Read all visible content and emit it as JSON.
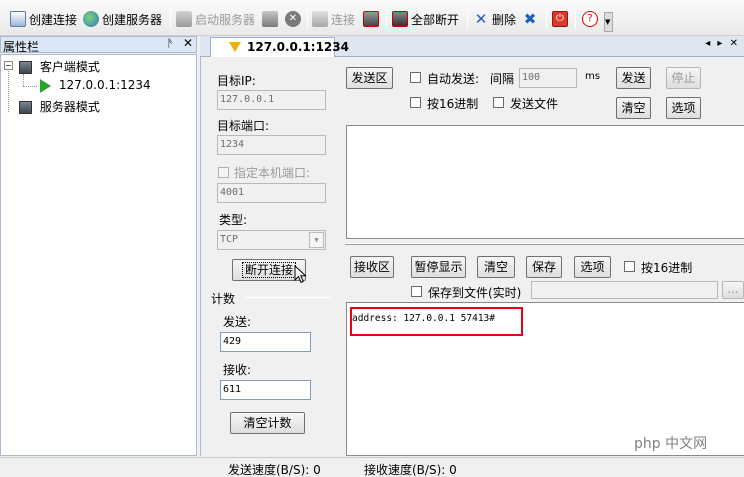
{
  "toolbar": {
    "create_connection": "创建连接",
    "create_server": "创建服务器",
    "start_server": "启动服务器",
    "connect": "连接",
    "disconnect_all": "全部断开",
    "delete": "删除"
  },
  "left_panel": {
    "title": "属性栏",
    "pin": "ᚫ",
    "close": "✕",
    "tree": {
      "client_mode": "客户端模式",
      "client_connection": "127.0.0.1:1234",
      "server_mode": "服务器模式"
    }
  },
  "tab": {
    "label": "127.0.0.1:1234",
    "nav": "◂ ▸ ✕"
  },
  "connection": {
    "target_ip_label": "目标IP:",
    "target_ip": "127.0.0.1",
    "target_port_label": "目标端口:",
    "target_port": "1234",
    "local_port_label": "指定本机端口:",
    "local_port": "4001",
    "type_label": "类型:",
    "type_value": "TCP",
    "disconnect_button": "断开连接"
  },
  "counts": {
    "title": "计数",
    "sent_label": "发送:",
    "sent": "429",
    "recv_label": "接收:",
    "recv": "611",
    "clear_button": "清空计数"
  },
  "send": {
    "area_button": "发送区",
    "auto_send": "自动发送:",
    "interval_label": "间隔",
    "interval": "100",
    "interval_unit": "ms",
    "send_button": "发送",
    "stop_button": "停止",
    "hex_label": "按16进制",
    "send_file_label": "发送文件",
    "clear_button": "清空",
    "options_button": "选项"
  },
  "receive": {
    "area_button": "接收区",
    "pause_button": "暂停显示",
    "clear_button": "清空",
    "save_button": "保存",
    "options_button": "选项",
    "hex_label": "按16进制",
    "save_to_file_label": "保存到文件(实时)",
    "browse": "...",
    "content": "address: 127.0.0.1 57413#"
  },
  "status": {
    "send_speed": "发送速度(B/S): 0",
    "recv_speed": "接收速度(B/S): 0"
  },
  "watermark": "php 中文网",
  "colors": {
    "highlight_box": "#e8001c",
    "panel_header": "#dce7f5",
    "play_arrow": "#2aa52a"
  }
}
